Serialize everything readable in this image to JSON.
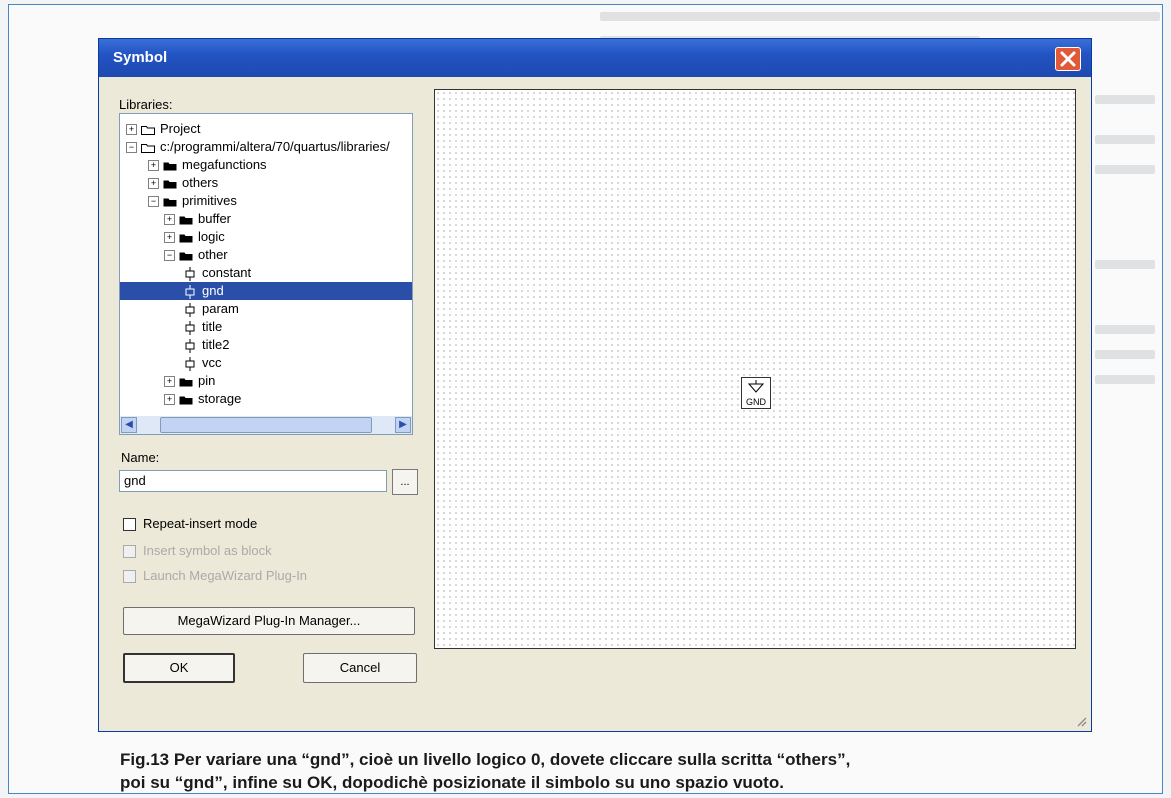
{
  "dialog": {
    "title": "Symbol",
    "libraries_label": "Libraries:",
    "tree": [
      {
        "label": "Project",
        "depth": 0,
        "kind": "folder",
        "expander": "+"
      },
      {
        "label": "c:/programmi/altera/70/quartus/libraries/",
        "depth": 0,
        "kind": "folder",
        "expander": "-"
      },
      {
        "label": "megafunctions",
        "depth": 1,
        "kind": "folder",
        "expander": "+"
      },
      {
        "label": "others",
        "depth": 1,
        "kind": "folder",
        "expander": "+"
      },
      {
        "label": "primitives",
        "depth": 1,
        "kind": "folder",
        "expander": "-"
      },
      {
        "label": "buffer",
        "depth": 2,
        "kind": "folder",
        "expander": "+"
      },
      {
        "label": "logic",
        "depth": 2,
        "kind": "folder",
        "expander": "+"
      },
      {
        "label": "other",
        "depth": 2,
        "kind": "folder",
        "expander": "-"
      },
      {
        "label": "constant",
        "depth": 3,
        "kind": "symbol"
      },
      {
        "label": "gnd",
        "depth": 3,
        "kind": "symbol",
        "selected": true
      },
      {
        "label": "param",
        "depth": 3,
        "kind": "symbol"
      },
      {
        "label": "title",
        "depth": 3,
        "kind": "symbol"
      },
      {
        "label": "title2",
        "depth": 3,
        "kind": "symbol"
      },
      {
        "label": "vcc",
        "depth": 3,
        "kind": "symbol"
      },
      {
        "label": "pin",
        "depth": 2,
        "kind": "folder",
        "expander": "+"
      },
      {
        "label": "storage",
        "depth": 2,
        "kind": "folder",
        "expander": "+"
      }
    ],
    "name_label": "Name:",
    "name_value": "gnd",
    "ellipsis_label": "...",
    "repeat_insert_label": "Repeat-insert mode",
    "insert_block_label": "Insert symbol as block",
    "launch_wizard_label": "Launch MegaWizard Plug-In",
    "megawizard_button": "MegaWizard Plug-In Manager...",
    "ok_button": "OK",
    "cancel_button": "Cancel",
    "preview_symbol_label": "GND"
  },
  "caption": {
    "line1": "Fig.13 Per variare una “gnd”, cioè un livello logico 0, dovete cliccare sulla scritta “others”,",
    "line2": "poi su “gnd”, infine su OK, dopodichè posizionate il simbolo su uno spazio vuoto."
  },
  "colors": {
    "titlebar": "#2354c4",
    "selection": "#2a4fa8",
    "close": "#e05a38",
    "frame_border": "#4a86c5"
  }
}
